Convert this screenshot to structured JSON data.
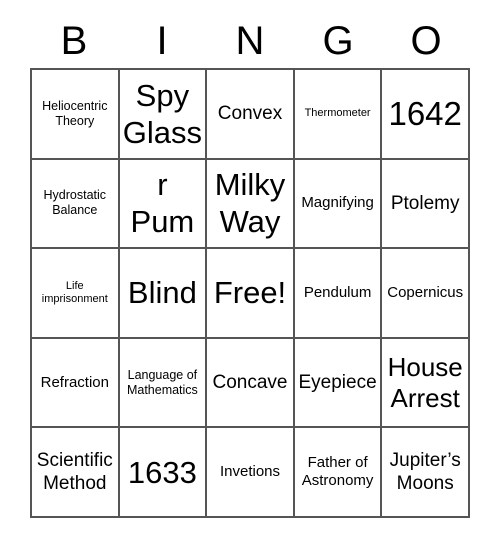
{
  "card": {
    "title": "BINGO",
    "header_letters": [
      "B",
      "I",
      "N",
      "G",
      "O"
    ],
    "free_space_label": "Free!",
    "colors": {
      "background": "#ffffff",
      "grid_line": "#555555",
      "text": "#000000"
    },
    "grid": {
      "columns": 5,
      "rows": 5,
      "cells": [
        {
          "text": "Heliocentric\nTheory",
          "size": "s"
        },
        {
          "text": "Spy\nGlass",
          "size": "xxl"
        },
        {
          "text": "Convex",
          "size": "l"
        },
        {
          "text": "Thermometer",
          "size": "xs"
        },
        {
          "text": "1642",
          "size": "huge"
        },
        {
          "text": "Hydrostatic\nBalance",
          "size": "s"
        },
        {
          "text": "Water\nPump",
          "size": "xxl"
        },
        {
          "text": "Milky\nWay",
          "size": "xxl"
        },
        {
          "text": "Magnifying",
          "size": "m"
        },
        {
          "text": "Ptolemy",
          "size": "l"
        },
        {
          "text": "Life\nimprisonment",
          "size": "xs"
        },
        {
          "text": "Blind",
          "size": "xxl"
        },
        {
          "text": "Free!",
          "size": "xxl"
        },
        {
          "text": "Pendulum",
          "size": "m"
        },
        {
          "text": "Copernicus",
          "size": "m"
        },
        {
          "text": "Refraction",
          "size": "m"
        },
        {
          "text": "Language of\nMathematics",
          "size": "s"
        },
        {
          "text": "Concave",
          "size": "l"
        },
        {
          "text": "Eyepiece",
          "size": "l"
        },
        {
          "text": "House\nArrest",
          "size": "xl"
        },
        {
          "text": "Scientific\nMethod",
          "size": "l"
        },
        {
          "text": "1633",
          "size": "xxl"
        },
        {
          "text": "Invetions",
          "size": "m"
        },
        {
          "text": "Father of\nAstronomy",
          "size": "m"
        },
        {
          "text": "Jupiter’s\nMoons",
          "size": "l"
        }
      ]
    }
  }
}
